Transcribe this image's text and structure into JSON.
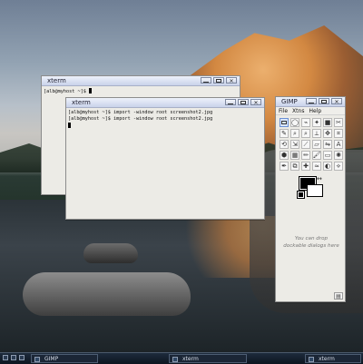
{
  "windows": {
    "xterm_back": {
      "title": "xterm",
      "lines": [
        "[alb@myhost ~]$ "
      ]
    },
    "xterm_front": {
      "title": "xterm",
      "lines": [
        "[alb@myhost ~]$ import -window root screenshot2.jpg",
        "[alb@myhost ~]$ import -window root screenshot2.jpg"
      ]
    },
    "gimp_toolbox": {
      "title": "GIMP",
      "menu": [
        "File",
        "Xtns",
        "Help"
      ],
      "drop_hint": "You can drop dockable dialogs here",
      "colors": {
        "foreground": "#000000",
        "background": "#ffffff"
      }
    }
  },
  "taskbar": {
    "items": [
      {
        "label": "GIMP",
        "icon": "gimp-icon"
      },
      {
        "label": "xterm",
        "icon": "terminal-icon"
      },
      {
        "label": "xterm",
        "icon": "terminal-icon"
      }
    ]
  },
  "window_buttons": {
    "min_icon": "minimize-icon",
    "max_icon": "maximize-icon",
    "close_icon": "close-icon"
  }
}
